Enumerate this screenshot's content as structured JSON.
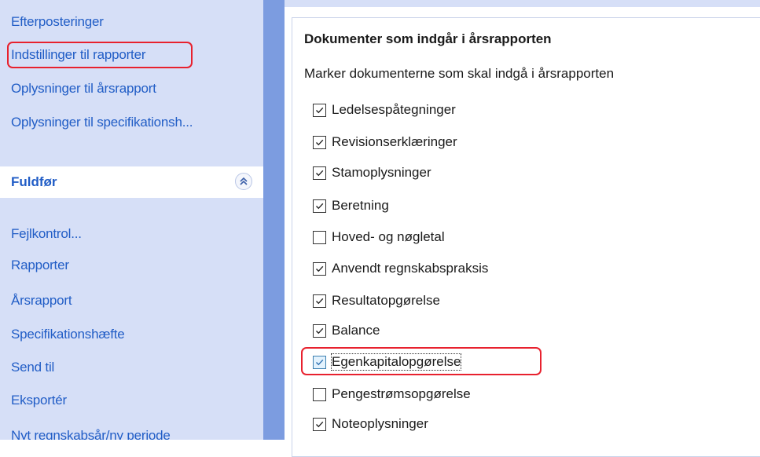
{
  "sidebar": {
    "links_top": [
      {
        "label": "Efterposteringer"
      },
      {
        "label": "Indstillinger til rapporter"
      },
      {
        "label": "Oplysninger til årsrapport"
      },
      {
        "label": "Oplysninger til specifikationsh..."
      }
    ],
    "section": {
      "title": "Fuldfør",
      "collapse_icon": "double-chevron-up-icon"
    },
    "links_bottom": [
      {
        "label": "Fejlkontrol..."
      },
      {
        "label": "Rapporter"
      },
      {
        "label": "Årsrapport"
      },
      {
        "label": "Specifikationshæfte"
      },
      {
        "label": "Send til"
      },
      {
        "label": "Eksportér"
      },
      {
        "label": "Nyt regnskabsår/ny periode"
      }
    ]
  },
  "main": {
    "group_title": "Dokumenter som indgår i årsrapporten",
    "group_desc": "Marker dokumenterne som skal indgå i årsrapporten",
    "documents": [
      {
        "label": "Ledelsespåtegninger",
        "checked": true
      },
      {
        "label": "Revisionserklæringer",
        "checked": true
      },
      {
        "label": "Stamoplysninger",
        "checked": true
      },
      {
        "label": "Beretning",
        "checked": true
      },
      {
        "label": "Hoved- og nøgletal",
        "checked": false
      },
      {
        "label": "Anvendt regnskabspraksis",
        "checked": true
      },
      {
        "label": "Resultatopgørelse",
        "checked": true
      },
      {
        "label": "Balance",
        "checked": true
      },
      {
        "label": "Egenkapitalopgørelse",
        "checked": true
      },
      {
        "label": "Pengestrømsopgørelse",
        "checked": false
      },
      {
        "label": "Noteoplysninger",
        "checked": true
      }
    ]
  },
  "colors": {
    "sidebar_bg": "#d6dff7",
    "link": "#215dc6",
    "divider": "#7c9ce0",
    "highlight": "#e8212e"
  }
}
